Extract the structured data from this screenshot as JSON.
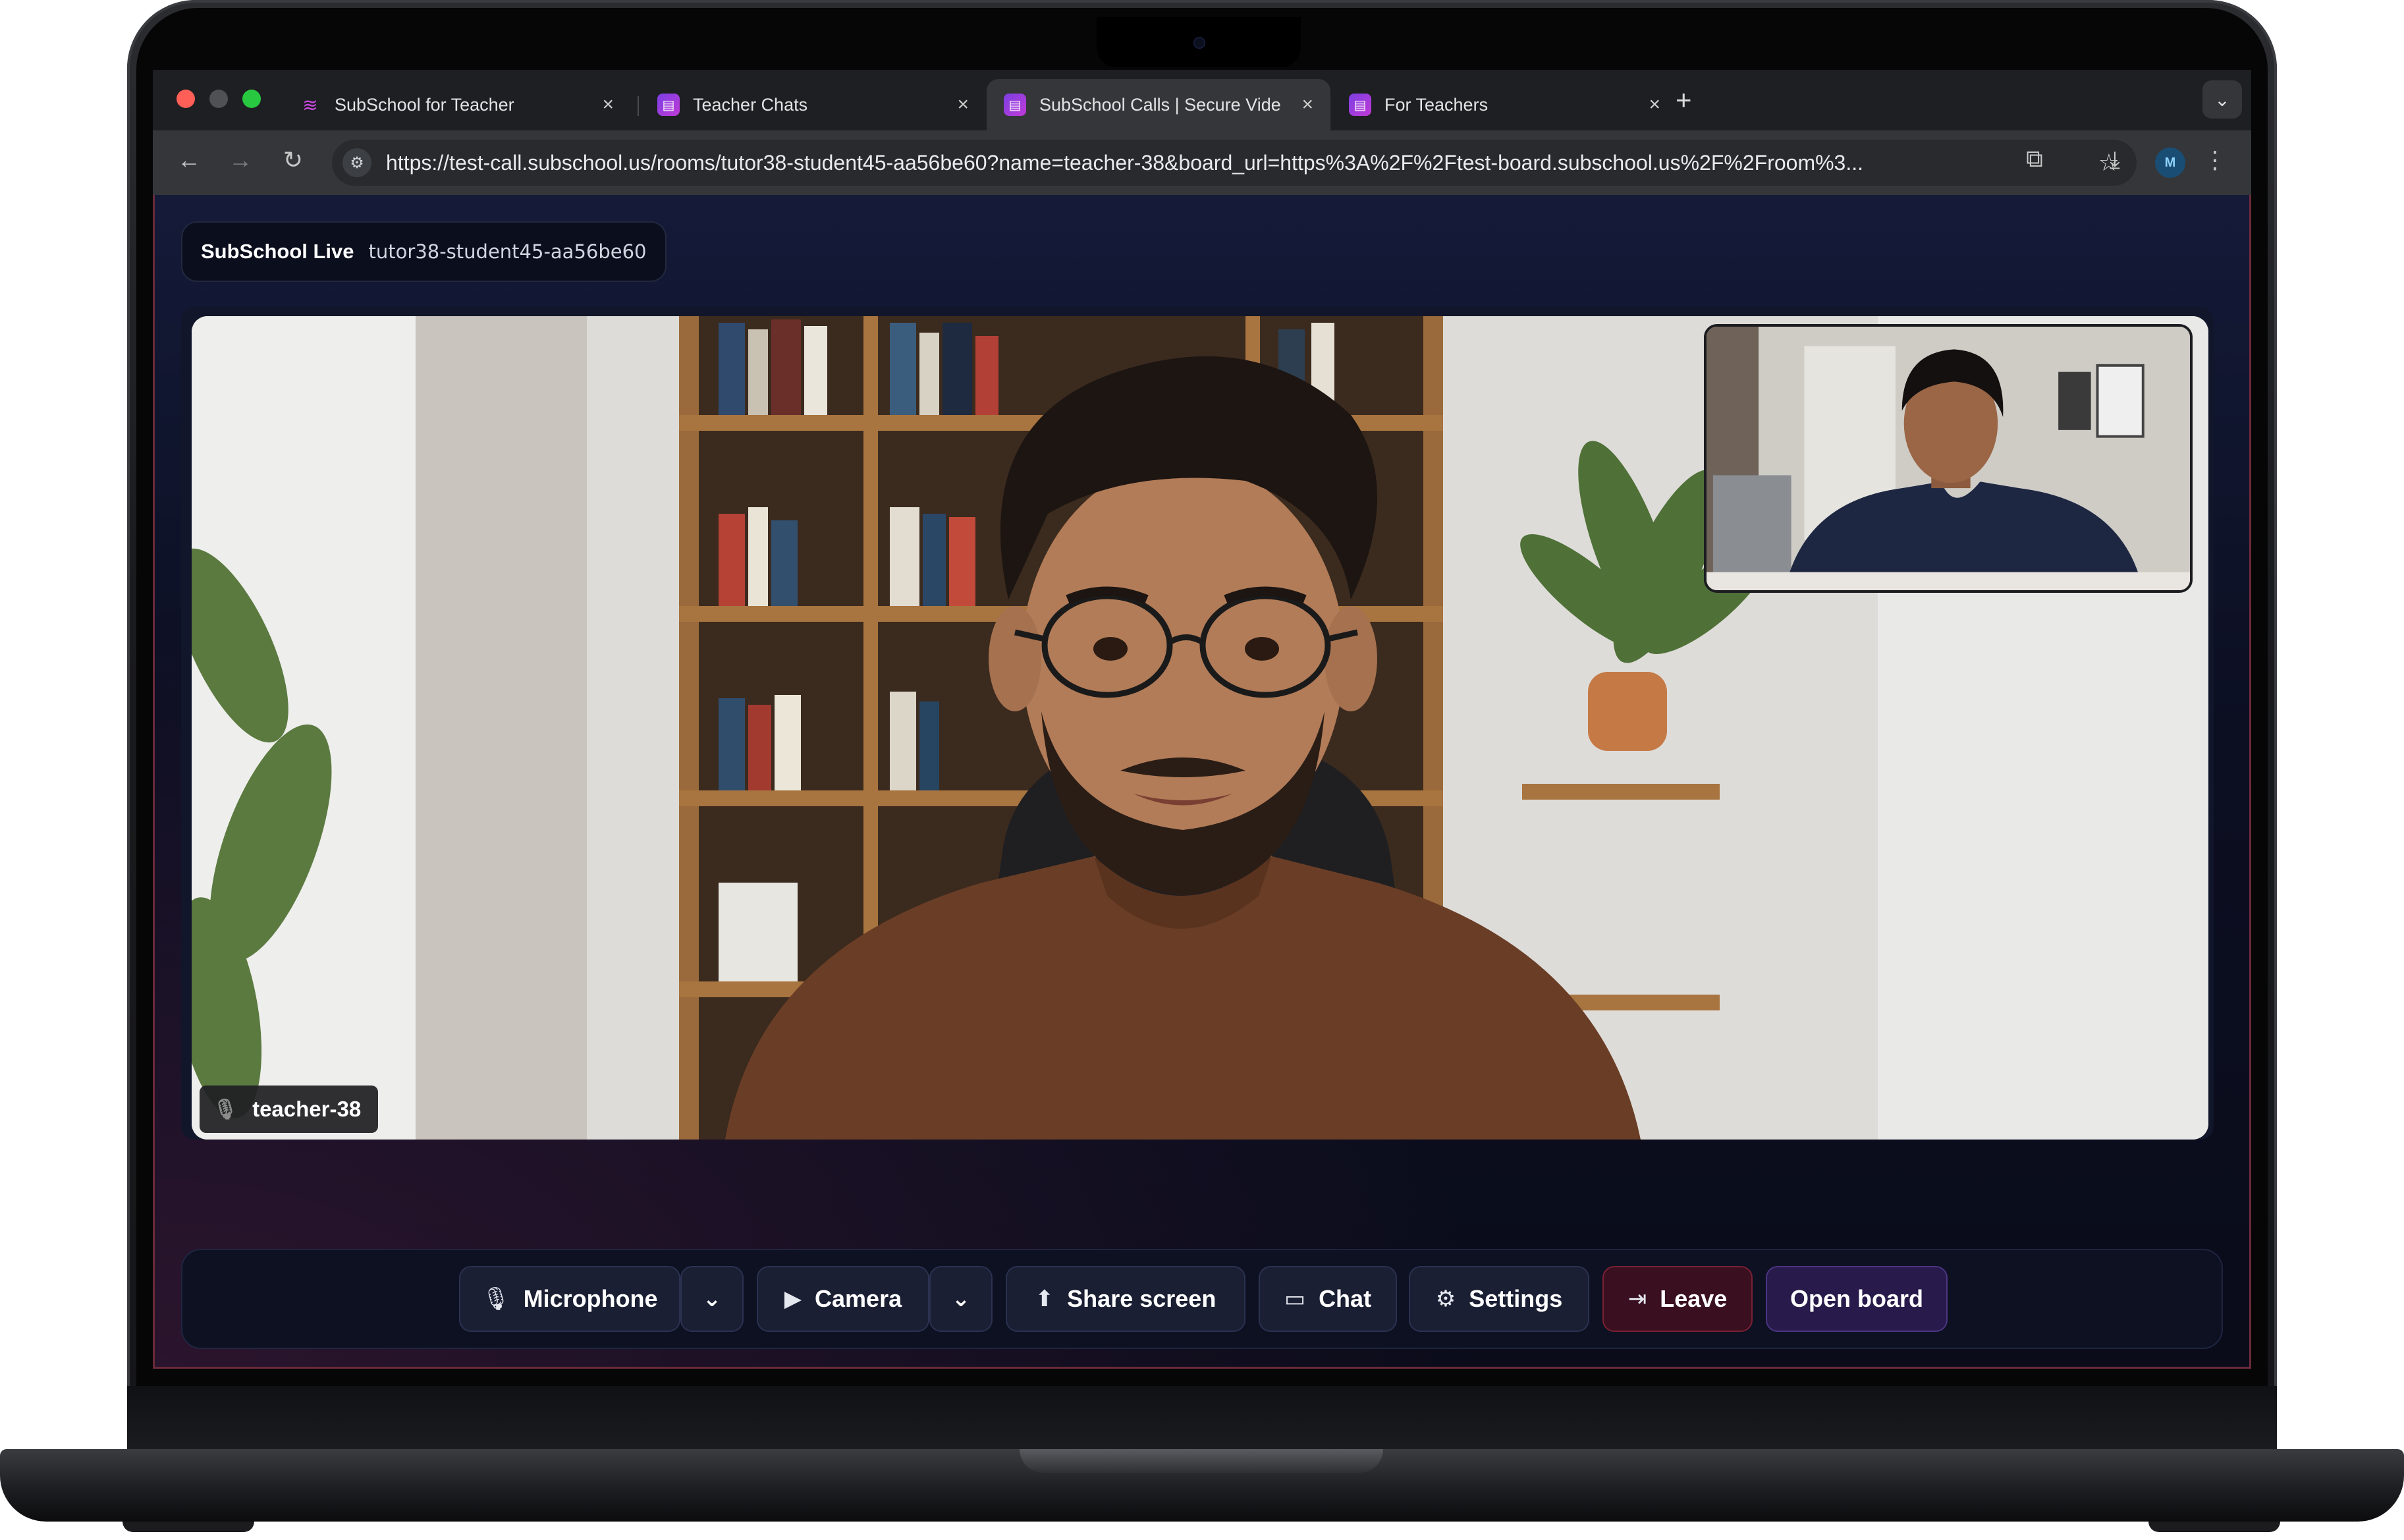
{
  "browser": {
    "tabs": [
      {
        "title": "SubSchool for Teacher",
        "active": false
      },
      {
        "title": "Teacher Chats",
        "active": false
      },
      {
        "title": "SubSchool Calls | Secure Vide",
        "active": true
      },
      {
        "title": "For Teachers",
        "active": false
      }
    ],
    "new_tab_label": "+",
    "url": "https://test-call.subschool.us/rooms/tutor38-student45-aa56be60?name=teacher-38&board_url=https%3A%2F%2Ftest-board.subschool.us%2F%2Froom%3..."
  },
  "header": {
    "brand": "SubSchool Live",
    "room_id": "tutor38-student45-aa56be60"
  },
  "main_video": {
    "participant_name": "teacher-38",
    "microphone_muted": true
  },
  "controls": {
    "microphone": "Microphone",
    "camera": "Camera",
    "share_screen": "Share screen",
    "chat": "Chat",
    "settings": "Settings",
    "leave": "Leave",
    "open_board": "Open board"
  },
  "colors": {
    "leave_accent": "#7a2034",
    "open_board_accent": "#4c3584",
    "page_background": "#0c0f22"
  }
}
